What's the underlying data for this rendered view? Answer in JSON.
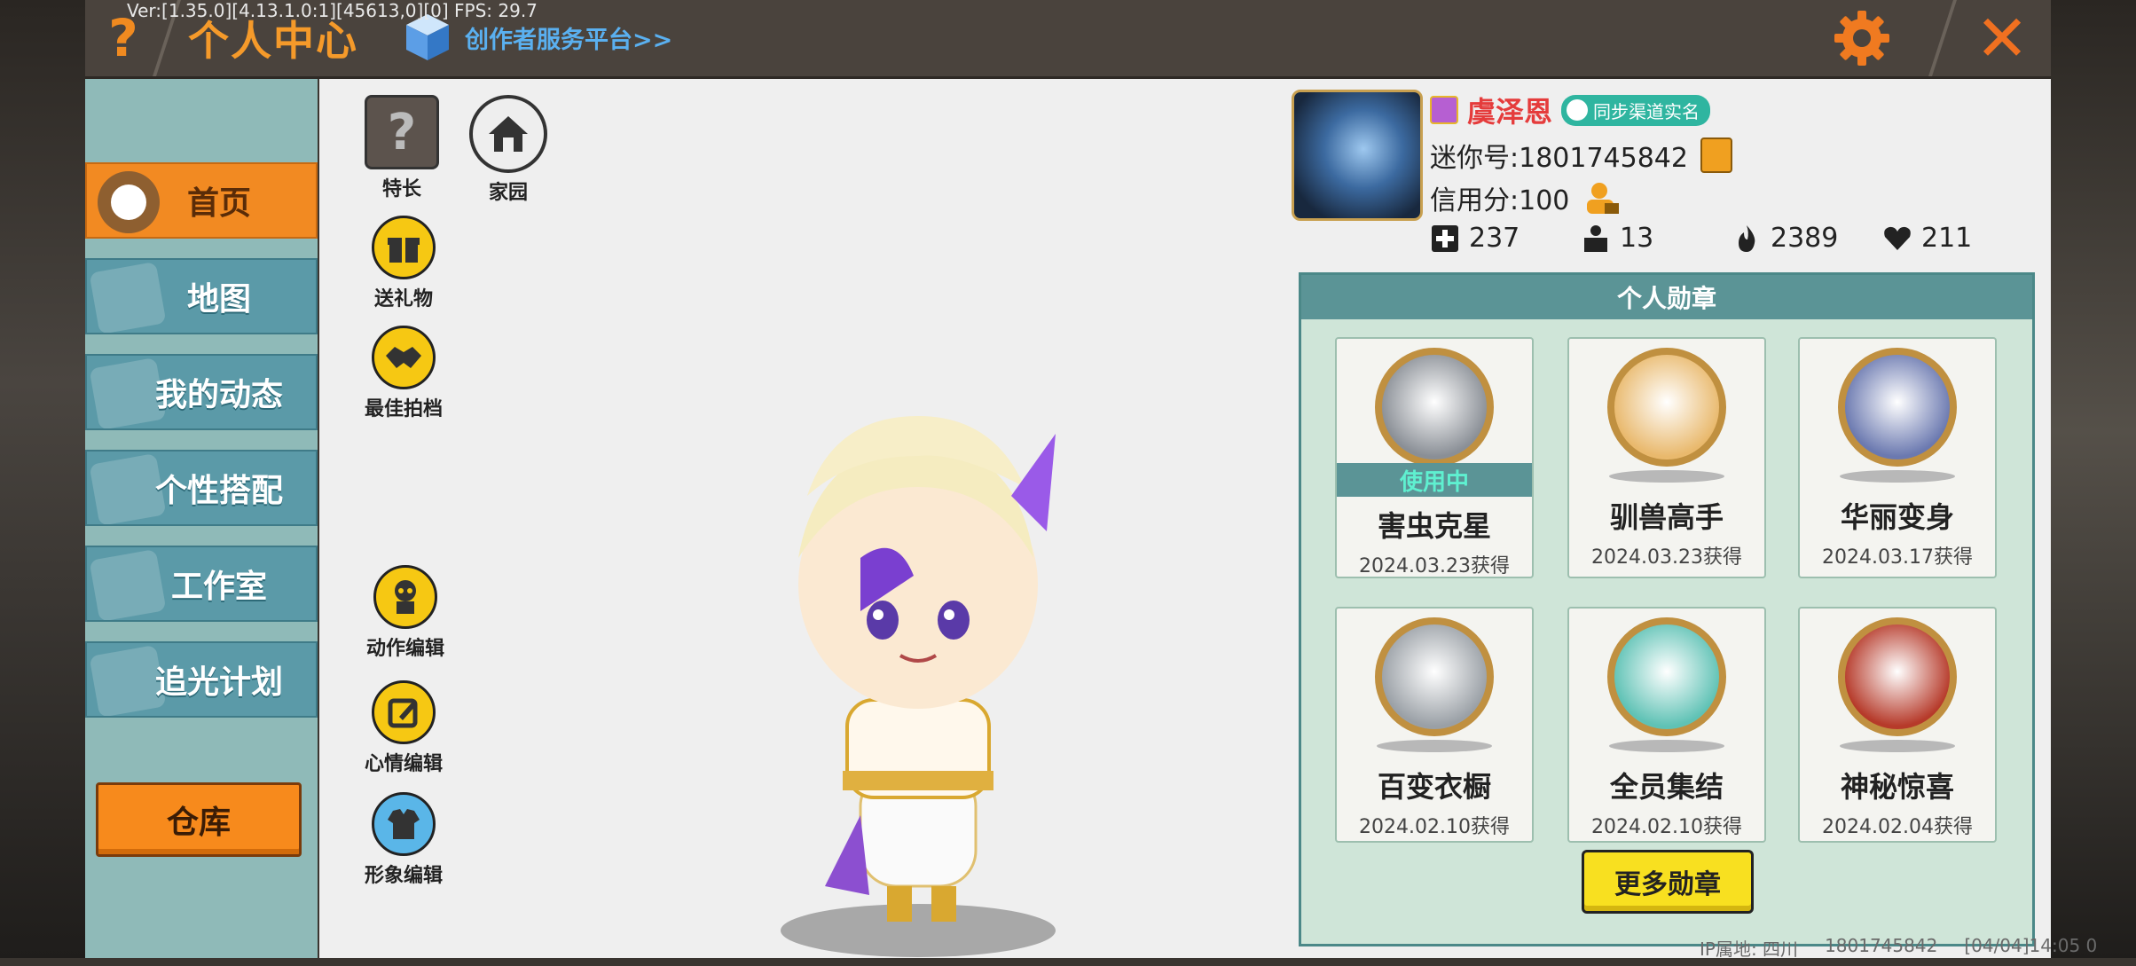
{
  "debug": {
    "version_text": "Ver:[1.35.0][4.13.1.0:1][45613,0][0] FPS: 29.7"
  },
  "header": {
    "title": "个人中心",
    "creator_link": "创作者服务平台>>",
    "help_glyph": "?",
    "close_glyph": "✕"
  },
  "sidebar": {
    "items": [
      {
        "label": "首页",
        "active": true
      },
      {
        "label": "地图"
      },
      {
        "label": "我的动态"
      },
      {
        "label": "个性搭配"
      },
      {
        "label": "工作室"
      },
      {
        "label": "追光计划"
      }
    ],
    "warehouse": "仓库"
  },
  "functions": {
    "specialty": "特长",
    "homeland": "家园",
    "send_gift": "送礼物",
    "best_partner": "最佳拍档",
    "action_edit": "动作编辑",
    "mood_edit": "心情编辑",
    "image_edit": "形象编辑"
  },
  "profile": {
    "name": "虞泽恩",
    "realname_badge": "同步渠道实名",
    "mini_id": "迷你号:1801745842",
    "credit": "信用分:100",
    "stats": [
      {
        "icon": "plus-icon",
        "value": "237"
      },
      {
        "icon": "podium-icon",
        "value": "13"
      },
      {
        "icon": "flame-icon",
        "value": "2389"
      },
      {
        "icon": "heart-icon",
        "value": "211"
      }
    ]
  },
  "badges": {
    "title": "个人勋章",
    "in_use_label": "使用中",
    "items": [
      {
        "name": "害虫克星",
        "date": "2024.03.23获得",
        "in_use": true,
        "color": "#8a8f96"
      },
      {
        "name": "驯兽高手",
        "date": "2024.03.23获得",
        "color": "#e9b96d"
      },
      {
        "name": "华丽变身",
        "date": "2024.03.17获得",
        "color": "#6b79b0"
      },
      {
        "name": "百变衣橱",
        "date": "2024.02.10获得",
        "color": "#9aa0a6"
      },
      {
        "name": "全员集结",
        "date": "2024.02.10获得",
        "color": "#5fc2b5"
      },
      {
        "name": "神秘惊喜",
        "date": "2024.02.04获得",
        "color": "#b63a2a"
      }
    ],
    "more_button": "更多勋章"
  },
  "footer": {
    "ip": "IP属地: 四川",
    "uid": "1801745842",
    "time": "[04/04]14:05 0"
  }
}
